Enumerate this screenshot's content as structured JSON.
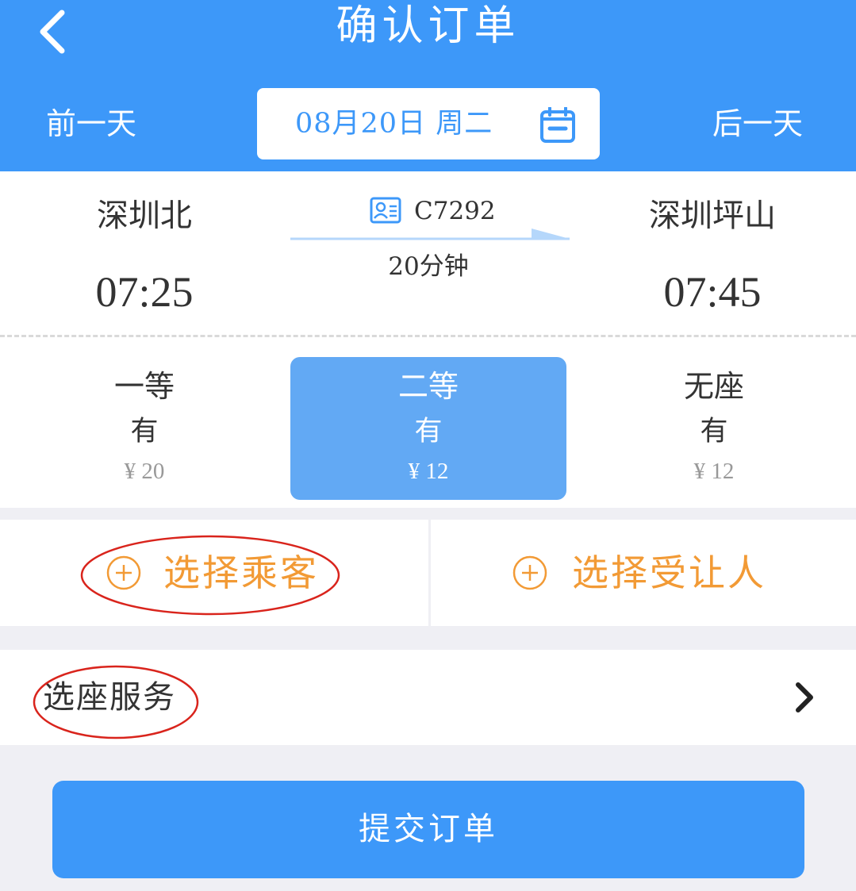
{
  "header": {
    "title": "确认订单",
    "prev_day": "前一天",
    "next_day": "后一天",
    "date": "08月20日  周二",
    "back_icon": "chevron-left-icon",
    "calendar_icon": "calendar-icon"
  },
  "train": {
    "from_station": "深圳北",
    "to_station": "深圳坪山",
    "from_time": "07:25",
    "to_time": "07:45",
    "train_no": "C7292",
    "duration": "20分钟"
  },
  "seats": [
    {
      "name": "一等",
      "availability": "有",
      "price": "¥ 20",
      "selected": false
    },
    {
      "name": "二等",
      "availability": "有",
      "price": "¥ 12",
      "selected": true
    },
    {
      "name": "无座",
      "availability": "有",
      "price": "¥ 12",
      "selected": false
    }
  ],
  "passengers": {
    "select_passenger": "选择乘客",
    "select_beneficiary": "选择受让人"
  },
  "seat_service": {
    "label": "选座服务"
  },
  "submit": {
    "label": "提交订单"
  },
  "colors": {
    "primary": "#3d98f9",
    "selected_seat": "#62a9f4",
    "accent_orange": "#f29a35",
    "annotation_red": "#d9241c"
  }
}
